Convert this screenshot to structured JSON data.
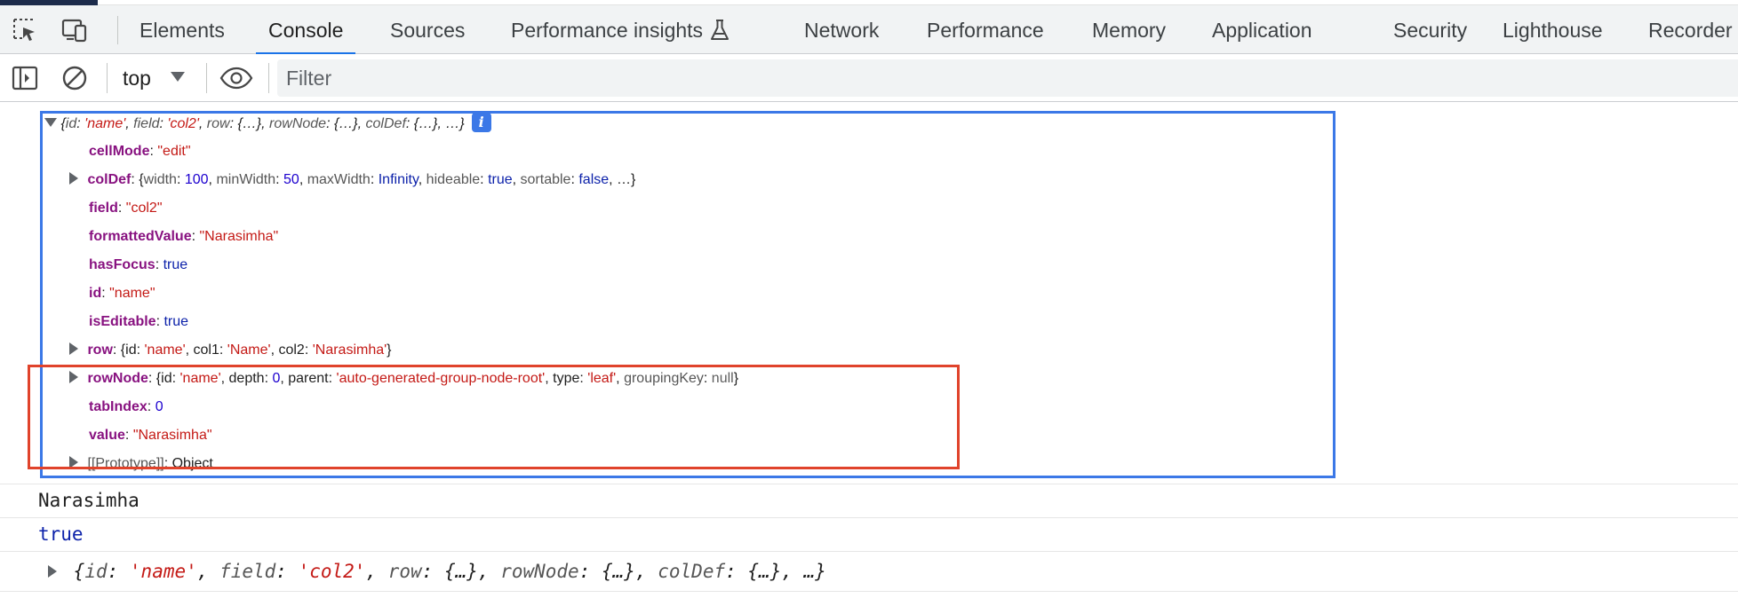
{
  "tabs": [
    {
      "label": "Elements"
    },
    {
      "label": "Console"
    },
    {
      "label": "Sources"
    },
    {
      "label": "Performance insights"
    },
    {
      "label": "Network"
    },
    {
      "label": "Performance"
    },
    {
      "label": "Memory"
    },
    {
      "label": "Application"
    },
    {
      "label": "Security"
    },
    {
      "label": "Lighthouse"
    },
    {
      "label": "Recorder"
    }
  ],
  "active_tab": "Console",
  "toolbar": {
    "context": "top",
    "filter_placeholder": "Filter",
    "filter_value": ""
  },
  "colors": {
    "highlight_box_outer": "#3b78e7",
    "highlight_box_inner": "#e0432b",
    "active_tab_underline": "#1a73e8"
  },
  "icons": {
    "inspect": "inspect-element-icon",
    "device": "device-toolbar-icon",
    "sidebar": "console-sidebar-icon",
    "clear": "clear-console-icon",
    "eye": "live-expression-eye-icon",
    "flask": "experimental-flask-icon",
    "info": "info-badge-icon"
  },
  "console": {
    "object_summary": {
      "id_key": "id",
      "id_val": "'name'",
      "field_key": "field",
      "field_val": "'col2'",
      "row_key": "row",
      "row_val": "{…}",
      "rownode_key": "rowNode",
      "rownode_val": "{…}",
      "coldef_key": "colDef",
      "coldef_val": "{…}",
      "ellipsis": "…",
      "info_badge": "i"
    },
    "props": {
      "cellMode": {
        "key": "cellMode",
        "val": "\"edit\""
      },
      "colDef": {
        "key": "colDef",
        "width_k": "width",
        "width_v": "100",
        "minWidth_k": "minWidth",
        "minWidth_v": "50",
        "maxWidth_k": "maxWidth",
        "maxWidth_v": "Infinity",
        "hideable_k": "hideable",
        "hideable_v": "true",
        "sortable_k": "sortable",
        "sortable_v": "false",
        "ellipsis": "…"
      },
      "field": {
        "key": "field",
        "val": "\"col2\""
      },
      "formattedValue": {
        "key": "formattedValue",
        "val": "\"Narasimha\""
      },
      "hasFocus": {
        "key": "hasFocus",
        "val": "true"
      },
      "id": {
        "key": "id",
        "val": "\"name\""
      },
      "isEditable": {
        "key": "isEditable",
        "val": "true"
      },
      "row": {
        "key": "row",
        "id_k": "id",
        "id_v": "'name'",
        "col1_k": "col1",
        "col1_v": "'Name'",
        "col2_k": "col2",
        "col2_v": "'Narasimha'"
      },
      "rowNode": {
        "key": "rowNode",
        "id_k": "id",
        "id_v": "'name'",
        "depth_k": "depth",
        "depth_v": "0",
        "parent_k": "parent",
        "parent_v": "'auto-generated-group-node-root'",
        "type_k": "type",
        "type_v": "'leaf'",
        "groupingKey_k": "groupingKey",
        "groupingKey_v": "null"
      },
      "tabIndex": {
        "key": "tabIndex",
        "val": "0"
      },
      "value": {
        "key": "value",
        "val": "\"Narasimha\""
      },
      "prototype": {
        "key": "[[Prototype]]",
        "val": "Object"
      }
    },
    "log_string": "Narasimha",
    "log_bool": "true"
  }
}
